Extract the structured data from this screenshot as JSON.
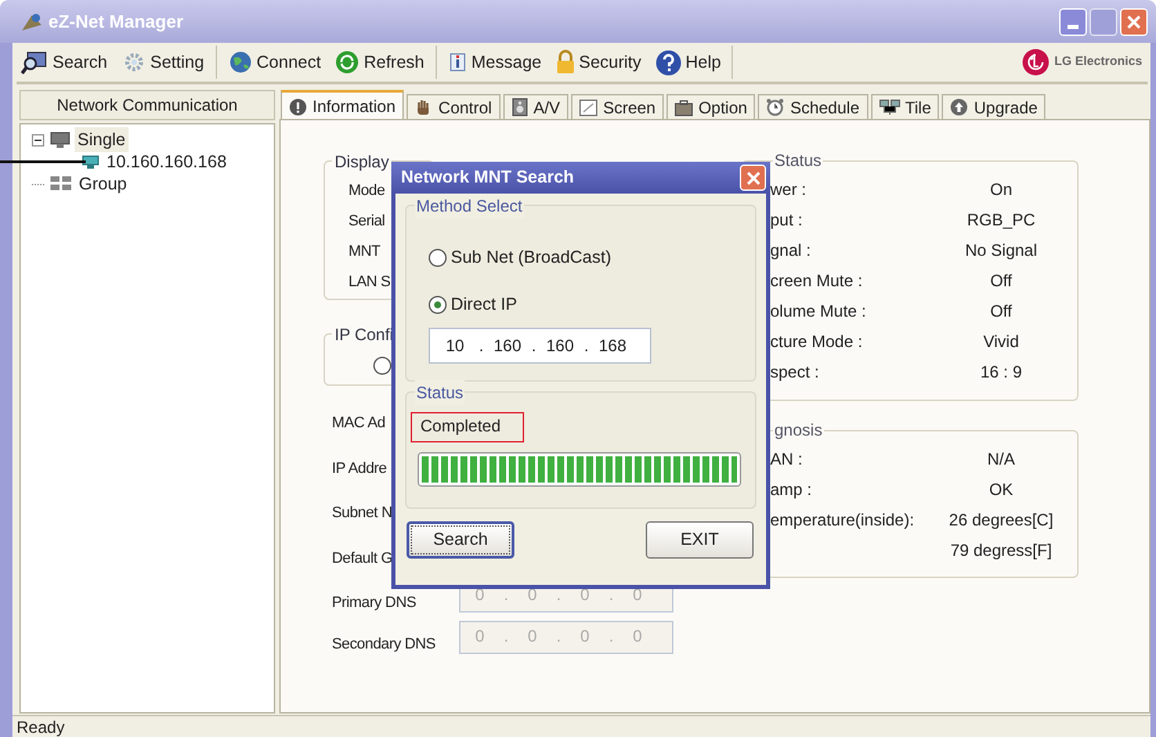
{
  "window": {
    "title": "eZ-Net Manager"
  },
  "toolbar": {
    "groups": [
      [
        {
          "label": "Search",
          "kind": "search"
        },
        {
          "label": "Setting",
          "kind": "setting"
        }
      ],
      [
        {
          "label": "Connect",
          "kind": "connect"
        },
        {
          "label": "Refresh",
          "kind": "refresh"
        }
      ],
      [
        {
          "label": "Message",
          "kind": "message"
        },
        {
          "label": "Security",
          "kind": "security"
        },
        {
          "label": "Help",
          "kind": "help"
        }
      ]
    ],
    "brand": "LG Electronics"
  },
  "sidebar": {
    "header": "Network Communication",
    "tree": [
      {
        "label": "Single",
        "kind": "single",
        "expanded": true,
        "selected": true,
        "children": [
          {
            "label": "10.160.160.168",
            "kind": "device",
            "selected": false
          }
        ]
      },
      {
        "label": "Group",
        "kind": "group",
        "selected": false
      }
    ]
  },
  "tabs": [
    {
      "label": "Information",
      "kind": "info",
      "selected": true
    },
    {
      "label": "Control",
      "kind": "control",
      "selected": false
    },
    {
      "label": "A/V",
      "kind": "av",
      "selected": false
    },
    {
      "label": "Screen",
      "kind": "screen",
      "selected": false
    },
    {
      "label": "Option",
      "kind": "option",
      "selected": false
    },
    {
      "label": "Schedule",
      "kind": "schedule",
      "selected": false
    },
    {
      "label": "Tile",
      "kind": "tile",
      "selected": false
    },
    {
      "label": "Upgrade",
      "kind": "upgrade",
      "selected": false
    }
  ],
  "information": {
    "display": {
      "title": "Display",
      "labels": [
        "Mode",
        "Serial",
        "MNT",
        "LAN S"
      ]
    },
    "ip_config": {
      "title": "IP Confi",
      "radio_selected": false
    },
    "fields": [
      {
        "label": "MAC Ad"
      },
      {
        "label": "IP Addre"
      },
      {
        "label": "Subnet N"
      },
      {
        "label": "Default G"
      },
      {
        "label": "Primary DNS",
        "segments": [
          "0",
          "0",
          "0",
          "0"
        ],
        "separator": "."
      },
      {
        "label": "Secondary DNS",
        "segments": [
          "0",
          "0",
          "0",
          "0"
        ],
        "separator": "."
      }
    ],
    "status": {
      "title": "Status",
      "rows": [
        {
          "label": "wer :",
          "value": "On"
        },
        {
          "label": "put :",
          "value": "RGB_PC"
        },
        {
          "label": "gnal :",
          "value": "No Signal"
        },
        {
          "label": "creen Mute :",
          "value": "Off"
        },
        {
          "label": "olume Mute :",
          "value": "Off"
        },
        {
          "label": "cture Mode :",
          "value": "Vivid"
        },
        {
          "label": "spect :",
          "value": "16 : 9"
        }
      ]
    },
    "diagnosis": {
      "title": "gnosis",
      "rows": [
        {
          "label": "AN :",
          "value": "N/A"
        },
        {
          "label": "amp :",
          "value": "OK"
        },
        {
          "label": "emperature(inside):",
          "value": "26 degrees[C]"
        },
        {
          "value": "79 degress[F]"
        }
      ]
    }
  },
  "dialog": {
    "title": "Network MNT Search",
    "method": {
      "title": "Method Select",
      "options": [
        {
          "label": "Sub Net (BroadCast)",
          "selected": false
        },
        {
          "label": "Direct IP",
          "selected": true
        }
      ]
    },
    "ip": {
      "segments": [
        "10",
        "160",
        "160",
        "168"
      ],
      "separator": "."
    },
    "status": {
      "title": "Status",
      "message": "Completed",
      "level": 1
    },
    "buttons": [
      {
        "label": "Search",
        "focused": true
      },
      {
        "label": "EXIT",
        "focused": false
      }
    ]
  },
  "status_bar": "Ready"
}
